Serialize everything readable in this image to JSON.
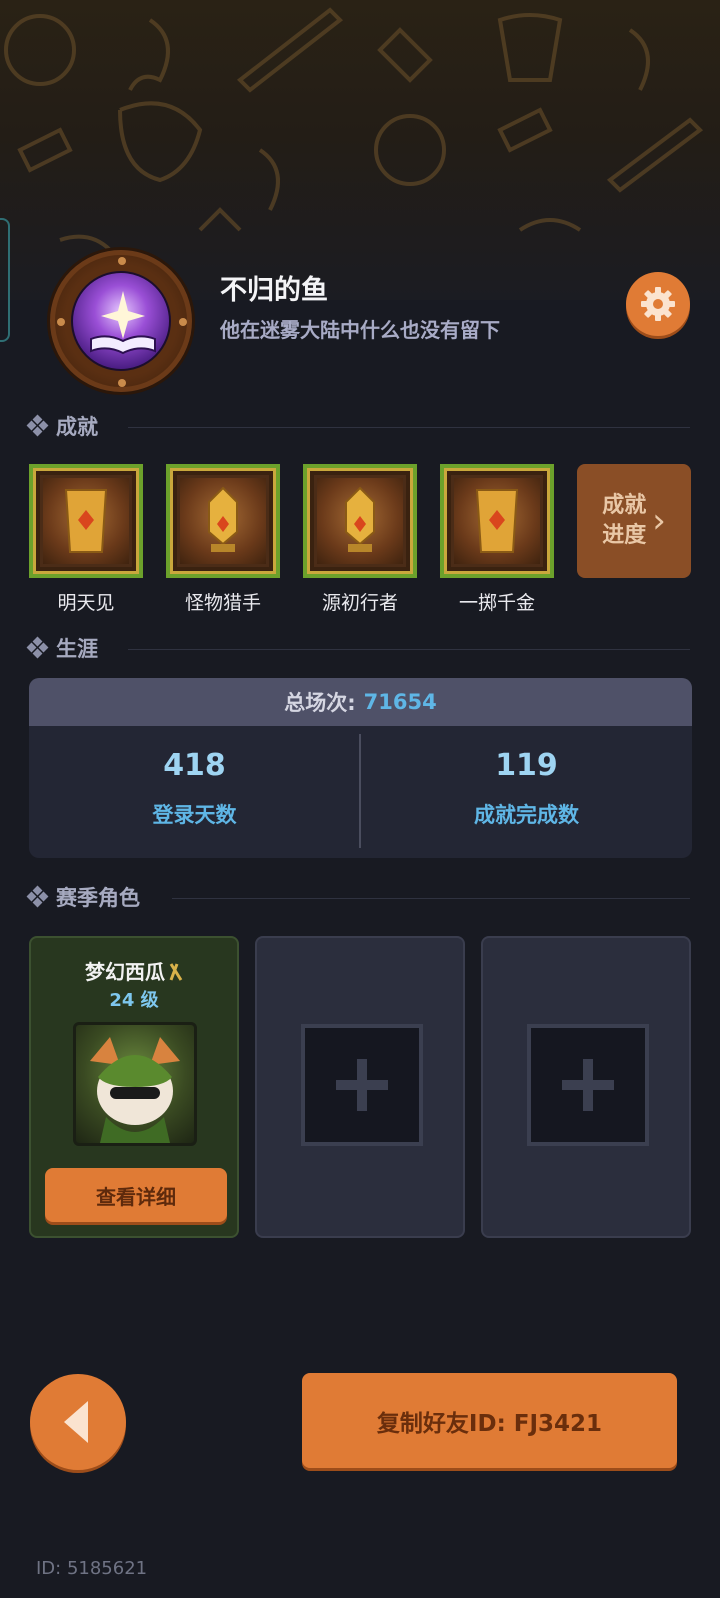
{
  "profile": {
    "name": "不归的鱼",
    "bio": "他在迷雾大陆中什么也没有留下",
    "avatar_icon": "glowing-book-icon",
    "settings_icon": "gear-icon"
  },
  "achievements": {
    "title": "成就",
    "items": [
      {
        "label": "明天见",
        "icon": "golden-banner-icon"
      },
      {
        "label": "怪物猎手",
        "icon": "golden-sword-icon"
      },
      {
        "label": "源初行者",
        "icon": "golden-sword-icon"
      },
      {
        "label": "一掷千金",
        "icon": "golden-banner-icon"
      }
    ],
    "progress_line1": "成就",
    "progress_line2": "进度",
    "progress_chevron": "›"
  },
  "career": {
    "title": "生涯",
    "total_label": "总场次:",
    "total_value": "71654",
    "stats": [
      {
        "value": "418",
        "label": "登录天数"
      },
      {
        "value": "119",
        "label": "成就完成数"
      }
    ]
  },
  "season": {
    "title": "赛季角色",
    "roles": [
      {
        "name": "梦幻西瓜",
        "level": "24 级",
        "button": "查看详细"
      }
    ],
    "empty_slot_icon": "plus-icon"
  },
  "bottom": {
    "back_icon": "back-arrow-icon",
    "copy_button": "复制好友ID: FJ3421",
    "user_id": "ID: 5185621"
  },
  "colors": {
    "accent_orange": "#e07b35",
    "value_blue": "#5fb6e6",
    "background": "#181a22"
  }
}
